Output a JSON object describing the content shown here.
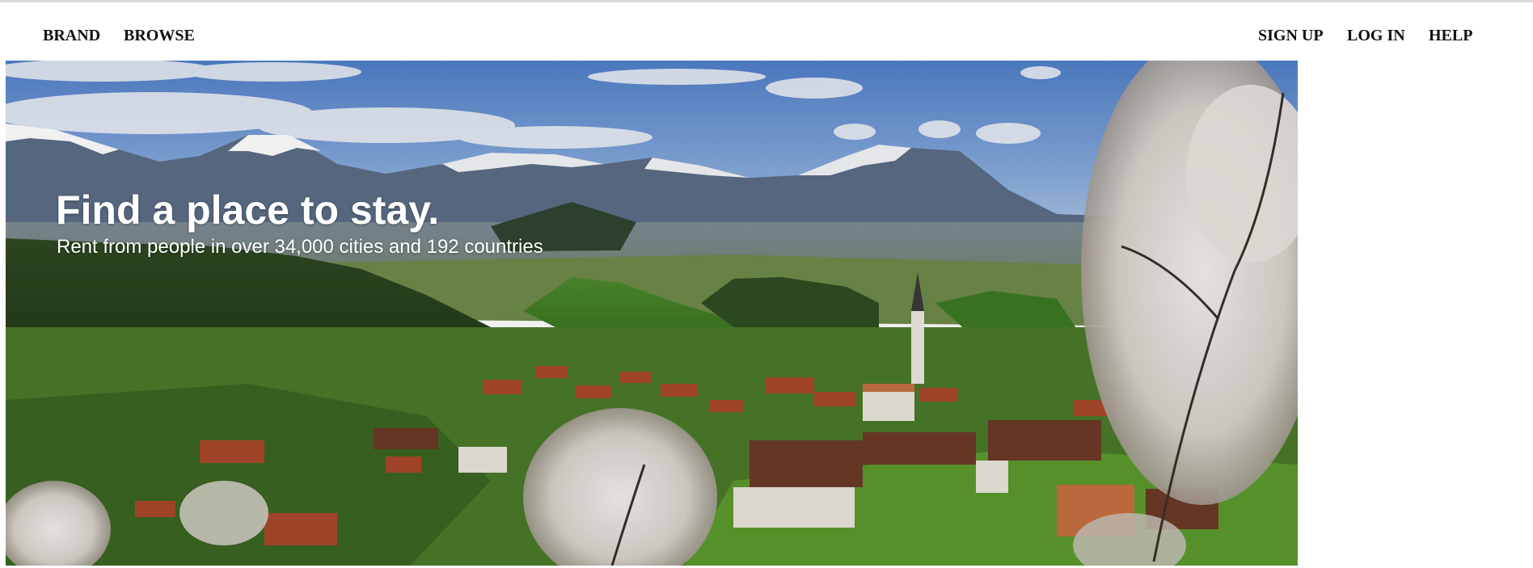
{
  "nav": {
    "brand": "BRAND",
    "browse": "BROWSE",
    "sign_up": "SIGN UP",
    "log_in": "LOG IN",
    "help": "HELP"
  },
  "hero": {
    "title": "Find a place to stay.",
    "subtitle": "Rent from people in over 34,000 cities and 192 countries"
  }
}
